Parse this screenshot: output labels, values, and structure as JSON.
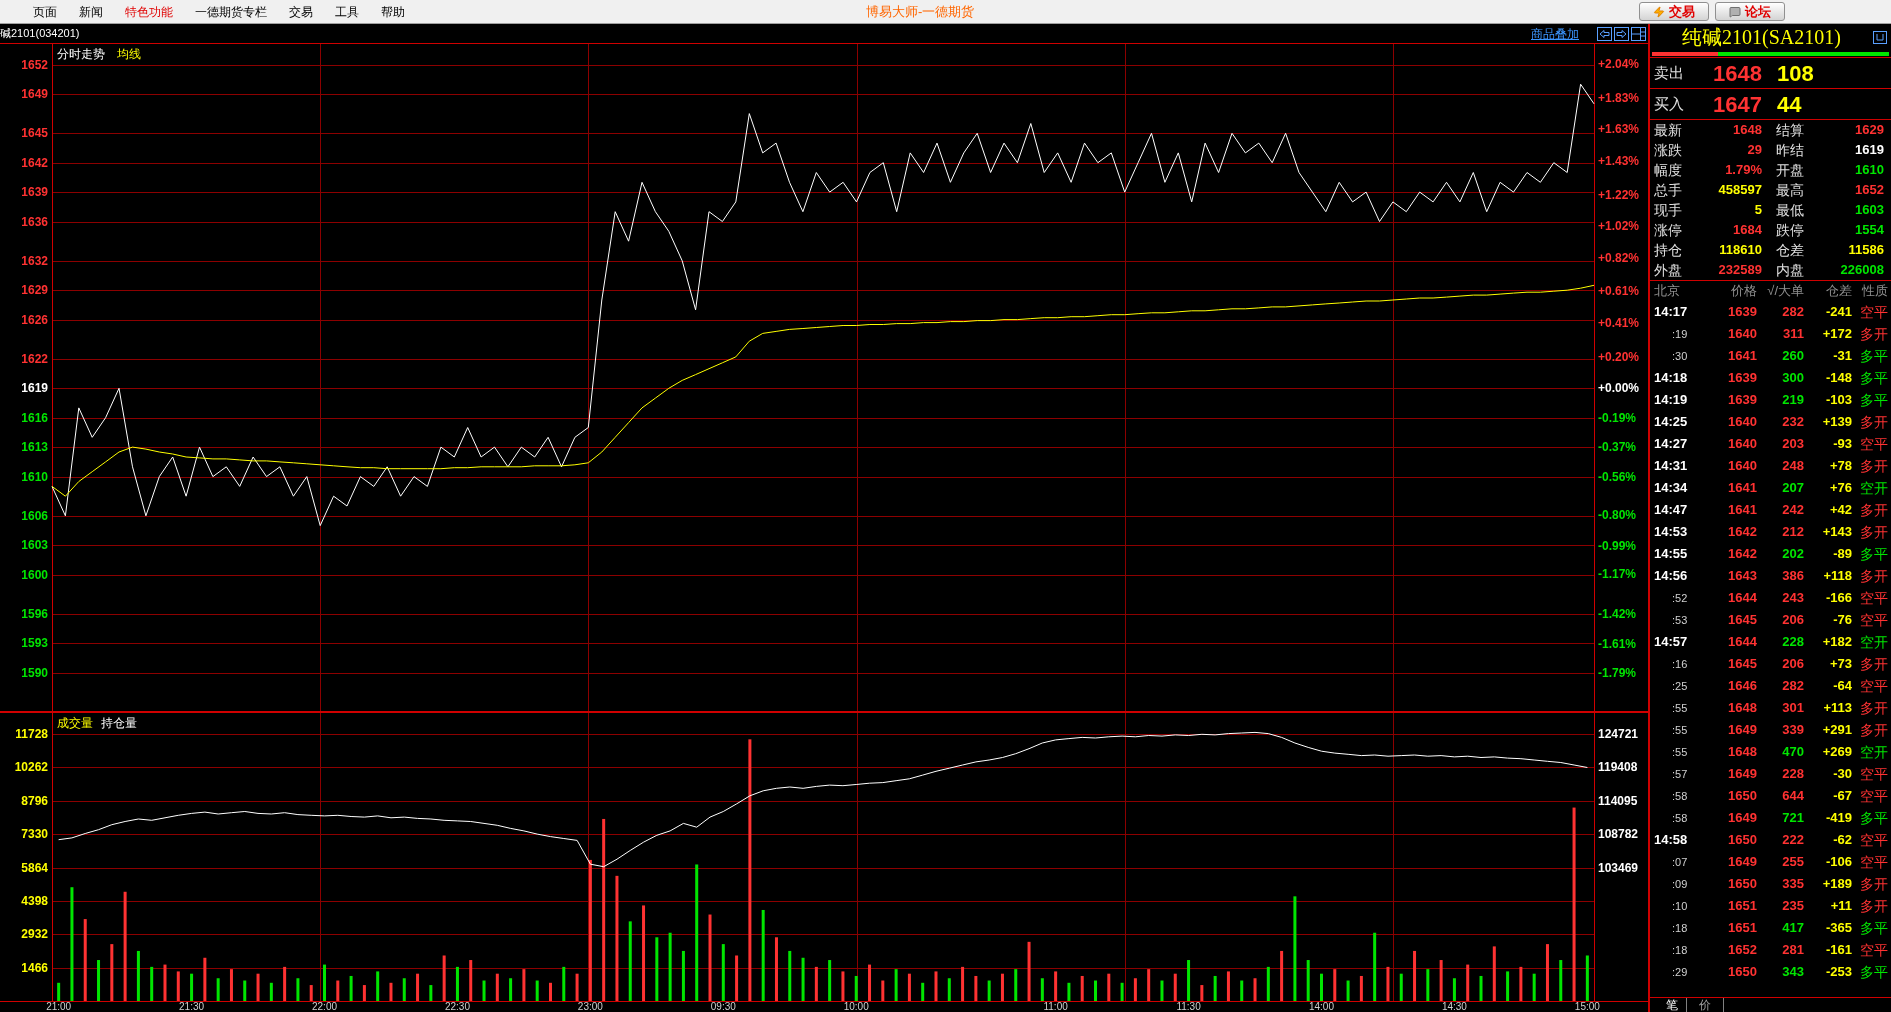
{
  "menu": {
    "items": [
      {
        "label": "页面",
        "highlighted": false
      },
      {
        "label": "新闻",
        "highlighted": false
      },
      {
        "label": "特色功能",
        "highlighted": true
      },
      {
        "label": "一德期货专栏",
        "highlighted": false
      },
      {
        "label": "交易",
        "highlighted": false
      },
      {
        "label": "工具",
        "highlighted": false
      },
      {
        "label": "帮助",
        "highlighted": false
      }
    ],
    "title": "博易大师-一德期货",
    "buttons": [
      "交易",
      "论坛"
    ]
  },
  "symbol_bar": {
    "contract": "碱2101(034201)",
    "overlay_link": "商品叠加"
  },
  "price_chart": {
    "chart_data": {
      "type": "line",
      "grid": true,
      "series": [
        {
          "name": "分时走势",
          "color": "#ffffff",
          "values": [
            1609,
            1606,
            1617,
            1614,
            1616,
            1619,
            1611,
            1606,
            1610,
            1612,
            1608,
            1613,
            1610,
            1611,
            1609,
            1612,
            1610,
            1611,
            1608,
            1610,
            1605,
            1608,
            1607,
            1610,
            1609,
            1611,
            1608,
            1610,
            1609,
            1613,
            1612,
            1615,
            1612,
            1613,
            1611,
            1613,
            1612,
            1614,
            1611,
            1614,
            1615,
            1628,
            1637,
            1634,
            1640,
            1637,
            1635,
            1632,
            1627,
            1637,
            1636,
            1638,
            1647,
            1643,
            1644,
            1640,
            1637,
            1641,
            1639,
            1640,
            1638,
            1641,
            1642,
            1637,
            1643,
            1641,
            1644,
            1640,
            1643,
            1645,
            1641,
            1644,
            1642,
            1646,
            1641,
            1643,
            1640,
            1644,
            1642,
            1643,
            1639,
            1642,
            1645,
            1640,
            1643,
            1638,
            1644,
            1641,
            1645,
            1643,
            1644,
            1642,
            1645,
            1641,
            1639,
            1637,
            1640,
            1638,
            1639,
            1636,
            1638,
            1637,
            1639,
            1638,
            1640,
            1638,
            1641,
            1637,
            1640,
            1639,
            1641,
            1640,
            1642,
            1641,
            1650,
            1648
          ]
        },
        {
          "name": "均线",
          "color": "#ffff00",
          "values": [
            1609,
            1608,
            1609.5,
            1610.5,
            1611.5,
            1612.5,
            1613,
            1612.8,
            1612.5,
            1612.3,
            1612,
            1611.9,
            1611.8,
            1611.8,
            1611.7,
            1611.6,
            1611.6,
            1611.5,
            1611.4,
            1611.3,
            1611.2,
            1611.1,
            1611,
            1610.9,
            1610.9,
            1610.8,
            1610.8,
            1610.8,
            1610.8,
            1610.8,
            1610.9,
            1610.9,
            1611,
            1611,
            1611,
            1611,
            1611.1,
            1611.1,
            1611.1,
            1611.2,
            1611.4,
            1612.5,
            1614,
            1615.5,
            1617,
            1618,
            1619,
            1619.8,
            1620.4,
            1621,
            1621.6,
            1622.2,
            1623.8,
            1624.6,
            1624.8,
            1625,
            1625.1,
            1625.2,
            1625.3,
            1625.4,
            1625.4,
            1625.5,
            1625.5,
            1625.6,
            1625.6,
            1625.7,
            1625.7,
            1625.8,
            1625.8,
            1625.9,
            1625.9,
            1626,
            1626,
            1626.1,
            1626.2,
            1626.2,
            1626.3,
            1626.3,
            1626.4,
            1626.5,
            1626.5,
            1626.6,
            1626.7,
            1626.7,
            1626.8,
            1626.9,
            1626.9,
            1627,
            1627.1,
            1627.1,
            1627.2,
            1627.3,
            1627.3,
            1627.4,
            1627.5,
            1627.6,
            1627.7,
            1627.8,
            1627.9,
            1627.9,
            1628,
            1628.1,
            1628.2,
            1628.2,
            1628.3,
            1628.4,
            1628.5,
            1628.5,
            1628.6,
            1628.7,
            1628.8,
            1628.8,
            1628.9,
            1629,
            1629.2,
            1629.5
          ]
        }
      ],
      "ylim": [
        1586.1,
        1654.1
      ],
      "y2lim": [
        -2.032,
        2.168
      ],
      "yticks": [
        1652,
        1649,
        1645,
        1642,
        1639,
        1636,
        1632,
        1629,
        1626,
        1622,
        1619,
        1616,
        1613,
        1610,
        1606,
        1603,
        1600,
        1596,
        1593,
        1590
      ],
      "y2ticks": [
        {
          "value": 2.04,
          "label": "+2.04%"
        },
        {
          "value": 1.83,
          "label": "+1.83%"
        },
        {
          "value": 1.63,
          "label": "+1.63%"
        },
        {
          "value": 1.43,
          "label": "+1.43%"
        },
        {
          "value": 1.22,
          "label": "+1.22%"
        },
        {
          "value": 1.02,
          "label": "+1.02%"
        },
        {
          "value": 0.82,
          "label": "+0.82%"
        },
        {
          "value": 0.61,
          "label": "+0.61%"
        },
        {
          "value": 0.41,
          "label": "+0.41%"
        },
        {
          "value": 0.2,
          "label": "+0.20%"
        },
        {
          "value": 0,
          "label": "+0.00%"
        },
        {
          "value": -0.19,
          "label": "-0.19%"
        },
        {
          "value": -0.37,
          "label": "-0.37%"
        },
        {
          "value": -0.56,
          "label": "-0.56%"
        },
        {
          "value": -0.8,
          "label": "-0.80%"
        },
        {
          "value": -0.99,
          "label": "-0.99%"
        },
        {
          "value": -1.17,
          "label": "-1.17%"
        },
        {
          "value": -1.42,
          "label": "-1.42%"
        },
        {
          "value": -1.61,
          "label": "-1.61%"
        },
        {
          "value": -1.79,
          "label": "-1.79%"
        }
      ]
    }
  },
  "volume_chart": {
    "chart_data": {
      "type": "bar",
      "title": "成交量",
      "grid": true,
      "categories": [
        "21:00",
        null,
        null,
        null,
        null,
        null,
        null,
        null,
        null,
        null,
        "21:30",
        null,
        null,
        null,
        null,
        null,
        null,
        null,
        null,
        null,
        "22:00",
        null,
        null,
        null,
        null,
        null,
        null,
        null,
        null,
        null,
        "22:30",
        null,
        null,
        null,
        null,
        null,
        null,
        null,
        null,
        null,
        "23:00",
        null,
        null,
        null,
        null,
        null,
        null,
        null,
        null,
        null,
        "09:30",
        null,
        null,
        null,
        null,
        null,
        null,
        null,
        null,
        null,
        "10:00",
        null,
        null,
        null,
        null,
        null,
        null,
        null,
        null,
        null,
        null,
        null,
        null,
        null,
        null,
        "11:00",
        null,
        null,
        null,
        null,
        null,
        null,
        null,
        null,
        null,
        "11:30",
        null,
        null,
        null,
        null,
        null,
        null,
        null,
        null,
        null,
        "14:00",
        null,
        null,
        null,
        null,
        null,
        null,
        null,
        null,
        null,
        "14:30",
        null,
        null,
        null,
        null,
        null,
        null,
        null,
        null,
        null,
        "15:00"
      ],
      "series": [
        {
          "values": [
            800,
            5000,
            3600,
            1800,
            2500,
            4800,
            2200,
            1500,
            1600,
            1300,
            1200,
            1900,
            1000,
            1400,
            900,
            1200,
            800,
            1500,
            1000,
            700,
            1600,
            900,
            1100,
            700,
            1300,
            800,
            1000,
            1200,
            700,
            2000,
            1500,
            1800,
            900,
            1200,
            1000,
            1400,
            900,
            800,
            1500,
            1200,
            6200,
            8000,
            5500,
            3500,
            4200,
            2800,
            3000,
            2200,
            6000,
            3800,
            2500,
            2000,
            11500,
            4000,
            2800,
            2200,
            1900,
            1500,
            1800,
            1300,
            1100,
            1600,
            900,
            1400,
            1200,
            800,
            1300,
            1000,
            1500,
            1100,
            900,
            1200,
            1400,
            2600,
            1000,
            1300,
            800,
            1100,
            900,
            1200,
            800,
            1000,
            1400,
            900,
            1200,
            1800,
            700,
            1100,
            1300,
            900,
            1000,
            1500,
            2200,
            4600,
            1800,
            1200,
            1400,
            900,
            1100,
            3000,
            1500,
            1200,
            2200,
            1400,
            1800,
            1000,
            1600,
            1100,
            2400,
            1300,
            1500,
            1200,
            2500,
            1800,
            8500,
            2000
          ],
          "colors": [
            "#00e600",
            "#00e600",
            "#ff3232",
            "#00e600",
            "#ff3232",
            "#ff3232",
            "#00e600",
            "#00e600",
            "#ff3232",
            "#ff3232",
            "#00e600",
            "#ff3232",
            "#00e600",
            "#ff3232",
            "#00e600",
            "#ff3232",
            "#00e600",
            "#ff3232",
            "#00e600",
            "#ff3232",
            "#00e600",
            "#ff3232",
            "#00e600",
            "#ff3232",
            "#00e600",
            "#ff3232",
            "#00e600",
            "#ff3232",
            "#00e600",
            "#ff3232",
            "#00e600",
            "#ff3232",
            "#00e600",
            "#ff3232",
            "#00e600",
            "#ff3232",
            "#00e600",
            "#ff3232",
            "#00e600",
            "#ff3232",
            "#ff3232",
            "#ff3232",
            "#ff3232",
            "#00e600",
            "#ff3232",
            "#00e600",
            "#00e600",
            "#00e600",
            "#00e600",
            "#ff3232",
            "#00e600",
            "#ff3232",
            "#ff3232",
            "#00e600",
            "#ff3232",
            "#00e600",
            "#00e600",
            "#ff3232",
            "#00e600",
            "#ff3232",
            "#00e600",
            "#ff3232",
            "#ff3232",
            "#00e600",
            "#ff3232",
            "#00e600",
            "#ff3232",
            "#00e600",
            "#ff3232",
            "#ff3232",
            "#00e600",
            "#ff3232",
            "#00e600",
            "#ff3232",
            "#00e600",
            "#ff3232",
            "#00e600",
            "#ff3232",
            "#00e600",
            "#ff3232",
            "#00e600",
            "#ff3232",
            "#ff3232",
            "#00e600",
            "#ff3232",
            "#00e600",
            "#ff3232",
            "#00e600",
            "#ff3232",
            "#00e600",
            "#ff3232",
            "#00e600",
            "#ff3232",
            "#00e600",
            "#00e600",
            "#00e600",
            "#ff3232",
            "#00e600",
            "#ff3232",
            "#00e600",
            "#ff3232",
            "#00e600",
            "#ff3232",
            "#00e600",
            "#ff3232",
            "#00e600",
            "#ff3232",
            "#00e600",
            "#ff3232",
            "#00e600",
            "#ff3232",
            "#00e600",
            "#ff3232",
            "#00e600",
            "#ff3232",
            "#00e600"
          ]
        },
        {
          "name": "持仓量",
          "color": "#ffffff",
          "type": "line",
          "axis": "y2",
          "values": [
            107900,
            108200,
            108900,
            109500,
            110300,
            110800,
            111200,
            111000,
            111400,
            111800,
            112100,
            112300,
            112000,
            112200,
            112400,
            112100,
            112000,
            112200,
            111900,
            111800,
            111700,
            111800,
            111600,
            111500,
            111700,
            111400,
            111500,
            111300,
            111200,
            111000,
            110900,
            110800,
            110500,
            110200,
            109700,
            109300,
            108800,
            108400,
            108100,
            107800,
            104000,
            103600,
            104800,
            106200,
            107500,
            108600,
            109300,
            110500,
            109900,
            111500,
            112400,
            113600,
            114900,
            115700,
            116100,
            116300,
            116100,
            116400,
            116600,
            116500,
            116700,
            116900,
            117000,
            117300,
            117600,
            118200,
            118800,
            119300,
            119800,
            120300,
            120600,
            121000,
            121600,
            122400,
            123300,
            123800,
            124000,
            124200,
            124100,
            124300,
            124400,
            124300,
            124500,
            124400,
            124600,
            124500,
            124700,
            124600,
            124800,
            124900,
            125000,
            124800,
            124200,
            123300,
            122600,
            122000,
            121700,
            121500,
            121300,
            121400,
            121200,
            121300,
            121400,
            121200,
            121300,
            121100,
            121200,
            121000,
            121100,
            120900,
            120800,
            120600,
            120400,
            120200,
            119800,
            119400
          ]
        }
      ],
      "ylim": [
        0,
        12700
      ],
      "yticks": [
        11728,
        10262,
        8796,
        7330,
        5864,
        4398,
        2932,
        1466
      ],
      "y2lim": [
        82217,
        128244
      ],
      "y2ticks": [
        124721,
        119408,
        114095,
        108782,
        103469
      ]
    }
  },
  "quote_panel": {
    "title": "纯碱2101(SA2101)",
    "ratio_bar": {
      "level": 0.28
    },
    "bid_ask": [
      {
        "label": "卖出",
        "price": "1648",
        "volume": "108"
      },
      {
        "label": "买入",
        "price": "1647",
        "volume": "44"
      }
    ],
    "stats": [
      {
        "label": "最新",
        "value": "1648",
        "color": "#ff3232"
      },
      {
        "label": "结算",
        "value": "1629",
        "color": "#ff3232"
      },
      {
        "label": "涨跌",
        "value": "29",
        "color": "#ff3232"
      },
      {
        "label": "昨结",
        "value": "1619",
        "color": "#ffffff"
      },
      {
        "label": "幅度",
        "value": "1.79%",
        "color": "#ff3232"
      },
      {
        "label": "开盘",
        "value": "1610",
        "color": "#00e600"
      },
      {
        "label": "总手",
        "value": "458597",
        "color": "#ffff00"
      },
      {
        "label": "最高",
        "value": "1652",
        "color": "#ff3232"
      },
      {
        "label": "现手",
        "value": "5",
        "color": "#ffff00"
      },
      {
        "label": "最低",
        "value": "1603",
        "color": "#00e600"
      },
      {
        "label": "涨停",
        "value": "1684",
        "color": "#ff3232"
      },
      {
        "label": "跌停",
        "value": "1554",
        "color": "#00e600"
      },
      {
        "label": "持仓",
        "value": "118610",
        "color": "#ffff00"
      },
      {
        "label": "仓差",
        "value": "11586",
        "color": "#ffff00"
      },
      {
        "label": "外盘",
        "value": "232589",
        "color": "#ff3232"
      },
      {
        "label": "内盘",
        "value": "226008",
        "color": "#00e600"
      }
    ],
    "trades": {
      "columns": [
        "北京",
        "价格",
        "√/大单",
        "仓差",
        "性质"
      ],
      "rows": [
        {
          "kind": "minute",
          "time": "14:17",
          "price": "1639",
          "volume": "282",
          "oi_change": "-241",
          "nature": "空平",
          "color": "#ff3232"
        },
        {
          "kind": "second",
          "time": ":19",
          "price": "1640",
          "volume": "311",
          "oi_change": "+172",
          "nature": "多开",
          "color": "#ff3232"
        },
        {
          "kind": "second",
          "time": ":30",
          "price": "1641",
          "volume": "260",
          "oi_change": "-31",
          "nature": "多平",
          "color": "#00e600"
        },
        {
          "kind": "minute",
          "time": "14:18",
          "price": "1639",
          "volume": "300",
          "oi_change": "-148",
          "nature": "多平",
          "color": "#00e600"
        },
        {
          "kind": "minute",
          "time": "14:19",
          "price": "1639",
          "volume": "219",
          "oi_change": "-103",
          "nature": "多平",
          "color": "#00e600"
        },
        {
          "kind": "minute",
          "time": "14:25",
          "price": "1640",
          "volume": "232",
          "oi_change": "+139",
          "nature": "多开",
          "color": "#ff3232"
        },
        {
          "kind": "minute",
          "time": "14:27",
          "price": "1640",
          "volume": "203",
          "oi_change": "-93",
          "nature": "空平",
          "color": "#ff3232"
        },
        {
          "kind": "minute",
          "time": "14:31",
          "price": "1640",
          "volume": "248",
          "oi_change": "+78",
          "nature": "多开",
          "color": "#ff3232"
        },
        {
          "kind": "minute",
          "time": "14:34",
          "price": "1641",
          "volume": "207",
          "oi_change": "+76",
          "nature": "空开",
          "color": "#00e600"
        },
        {
          "kind": "minute",
          "time": "14:47",
          "price": "1641",
          "volume": "242",
          "oi_change": "+42",
          "nature": "多开",
          "color": "#ff3232"
        },
        {
          "kind": "minute",
          "time": "14:53",
          "price": "1642",
          "volume": "212",
          "oi_change": "+143",
          "nature": "多开",
          "color": "#ff3232"
        },
        {
          "kind": "minute",
          "time": "14:55",
          "price": "1642",
          "volume": "202",
          "oi_change": "-89",
          "nature": "多平",
          "color": "#00e600"
        },
        {
          "kind": "minute",
          "time": "14:56",
          "price": "1643",
          "volume": "386",
          "oi_change": "+118",
          "nature": "多开",
          "color": "#ff3232"
        },
        {
          "kind": "second",
          "time": ":52",
          "price": "1644",
          "volume": "243",
          "oi_change": "-166",
          "nature": "空平",
          "color": "#ff3232"
        },
        {
          "kind": "second",
          "time": ":53",
          "price": "1645",
          "volume": "206",
          "oi_change": "-76",
          "nature": "空平",
          "color": "#ff3232"
        },
        {
          "kind": "minute",
          "time": "14:57",
          "price": "1644",
          "volume": "228",
          "oi_change": "+182",
          "nature": "空开",
          "color": "#00e600"
        },
        {
          "kind": "second",
          "time": ":16",
          "price": "1645",
          "volume": "206",
          "oi_change": "+73",
          "nature": "多开",
          "color": "#ff3232"
        },
        {
          "kind": "second",
          "time": ":25",
          "price": "1646",
          "volume": "282",
          "oi_change": "-64",
          "nature": "空平",
          "color": "#ff3232"
        },
        {
          "kind": "second",
          "time": ":55",
          "price": "1648",
          "volume": "301",
          "oi_change": "+113",
          "nature": "多开",
          "color": "#ff3232"
        },
        {
          "kind": "second",
          "time": ":55",
          "price": "1649",
          "volume": "339",
          "oi_change": "+291",
          "nature": "多开",
          "color": "#ff3232"
        },
        {
          "kind": "second",
          "time": ":55",
          "price": "1648",
          "volume": "470",
          "oi_change": "+269",
          "nature": "空开",
          "color": "#00e600"
        },
        {
          "kind": "second",
          "time": ":57",
          "price": "1649",
          "volume": "228",
          "oi_change": "-30",
          "nature": "空平",
          "color": "#ff3232"
        },
        {
          "kind": "second",
          "time": ":58",
          "price": "1650",
          "volume": "644",
          "oi_change": "-67",
          "nature": "空平",
          "color": "#ff3232"
        },
        {
          "kind": "second",
          "time": ":58",
          "price": "1649",
          "volume": "721",
          "oi_change": "-419",
          "nature": "多平",
          "color": "#00e600"
        },
        {
          "kind": "minute",
          "time": "14:58",
          "price": "1650",
          "volume": "222",
          "oi_change": "-62",
          "nature": "空平",
          "color": "#ff3232"
        },
        {
          "kind": "second",
          "time": ":07",
          "price": "1649",
          "volume": "255",
          "oi_change": "-106",
          "nature": "空平",
          "color": "#ff3232"
        },
        {
          "kind": "second",
          "time": ":09",
          "price": "1650",
          "volume": "335",
          "oi_change": "+189",
          "nature": "多开",
          "color": "#ff3232"
        },
        {
          "kind": "second",
          "time": ":10",
          "price": "1651",
          "volume": "235",
          "oi_change": "+11",
          "nature": "多开",
          "color": "#ff3232"
        },
        {
          "kind": "second",
          "time": ":18",
          "price": "1651",
          "volume": "417",
          "oi_change": "-365",
          "nature": "多平",
          "color": "#00e600"
        },
        {
          "kind": "second",
          "time": ":18",
          "price": "1652",
          "volume": "281",
          "oi_change": "-161",
          "nature": "空平",
          "color": "#ff3232"
        },
        {
          "kind": "second",
          "time": ":29",
          "price": "1650",
          "volume": "343",
          "oi_change": "-253",
          "nature": "多平",
          "color": "#00e600"
        }
      ]
    },
    "tabs": [
      {
        "label": "笔",
        "selected": true
      },
      {
        "label": "价",
        "selected": false
      }
    ]
  }
}
